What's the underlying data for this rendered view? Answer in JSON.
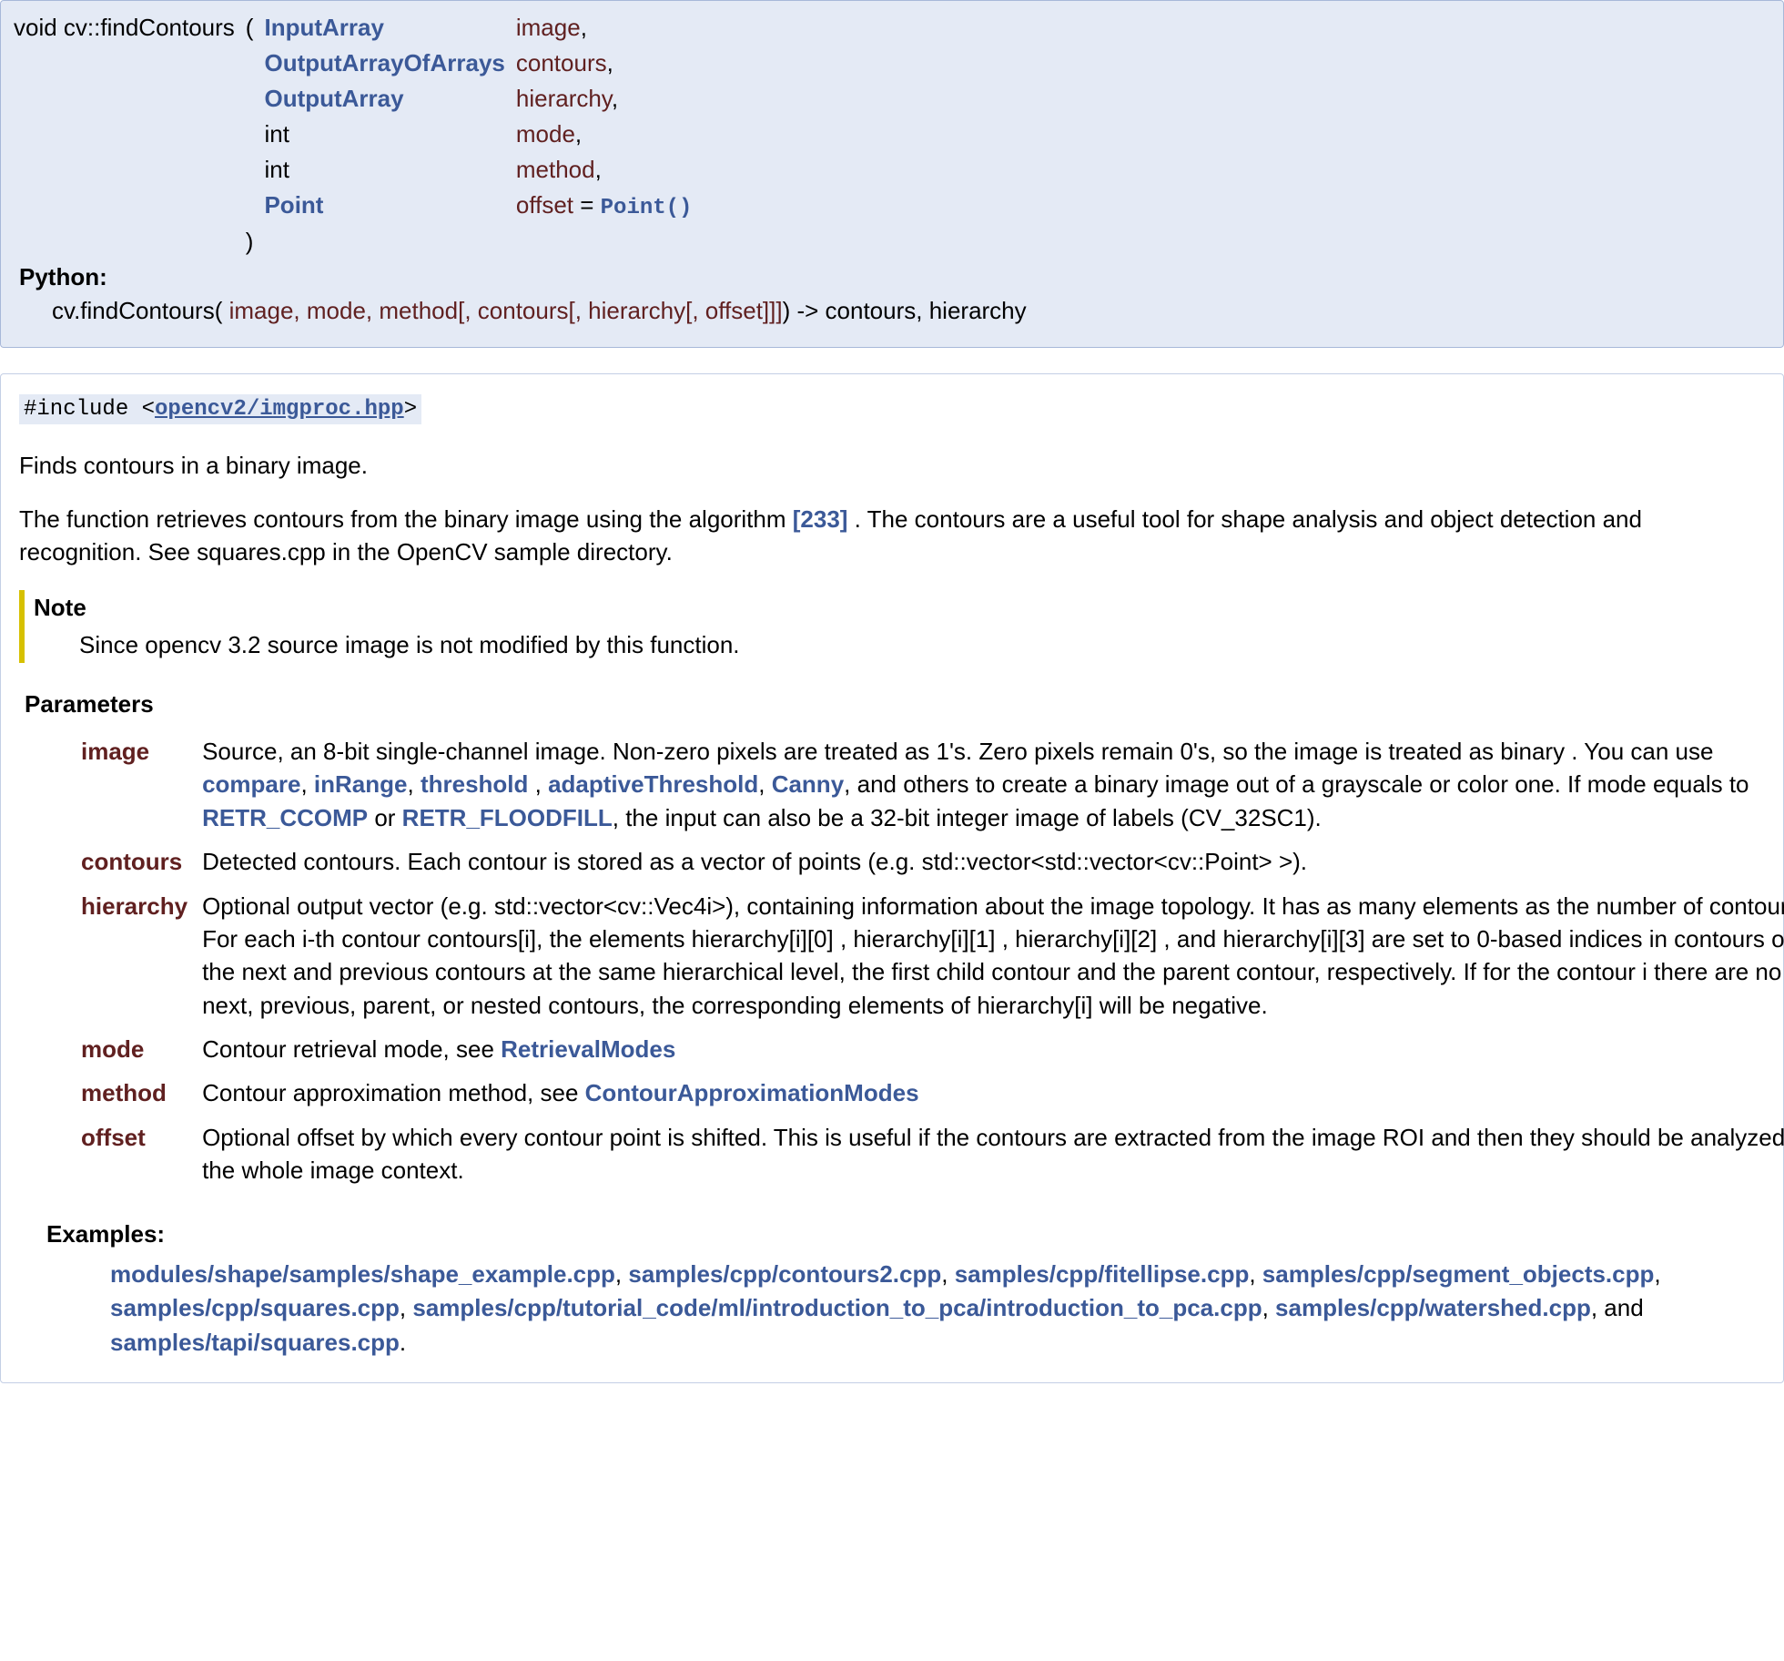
{
  "proto": {
    "rettype": "void cv::findContours",
    "openparen": "(",
    "closeparen": ")",
    "params": [
      {
        "type": "InputArray",
        "type_is_link": true,
        "name": "image",
        "comma": ","
      },
      {
        "type": "OutputArrayOfArrays",
        "type_is_link": true,
        "name": "contours",
        "comma": ","
      },
      {
        "type": "OutputArray",
        "type_is_link": true,
        "name": "hierarchy",
        "comma": ","
      },
      {
        "type": "int",
        "type_is_link": false,
        "name": "mode",
        "comma": ","
      },
      {
        "type": "int",
        "type_is_link": false,
        "name": "method",
        "comma": ","
      },
      {
        "type": "Point",
        "type_is_link": true,
        "name": "offset",
        "default_prefix": " = ",
        "default_code": "Point()",
        "comma": ""
      }
    ]
  },
  "python": {
    "label": "Python:",
    "sig_prefix": "cv.findContours(",
    "args": [
      " image",
      ", mode",
      ", method[",
      ", contours[",
      ", hierarchy[",
      ", offset]]]",
      " "
    ],
    "sig_suffix": ") -> contours, hierarchy"
  },
  "include": {
    "prefix": "#include <",
    "path": "opencv2/imgproc.hpp",
    "suffix": ">"
  },
  "brief": "Finds contours in a binary image.",
  "desc": {
    "part1": "The function retrieves contours from the binary image using the algorithm ",
    "cite": "[233]",
    "part2": " . The contours are a useful tool for shape analysis and object detection and recognition. See squares.cpp in the OpenCV sample directory."
  },
  "note": {
    "heading": "Note",
    "body": "Since opencv 3.2 source image is not modified by this function."
  },
  "params_heading": "Parameters",
  "params": [
    {
      "name": "image",
      "desc": {
        "pre": "Source, an 8-bit single-channel image. Non-zero pixels are treated as 1's. Zero pixels remain 0's, so the image is treated as binary . You can use ",
        "l1": "compare",
        "c1": ", ",
        "l2": "inRange",
        "c2": ", ",
        "l3": "threshold",
        "c3": " , ",
        "l4": "adaptiveThreshold",
        "c4": ", ",
        "l5": "Canny",
        "mid": ", and others to create a binary image out of a grayscale or color one. If mode equals to ",
        "l6": "RETR_CCOMP",
        "c5": " or ",
        "l7": "RETR_FLOODFILL",
        "post": ", the input can also be a 32-bit integer image of labels (CV_32SC1)."
      }
    },
    {
      "name": "contours",
      "desc": {
        "text": "Detected contours. Each contour is stored as a vector of points (e.g. std::vector<std::vector<cv::Point> >)."
      }
    },
    {
      "name": "hierarchy",
      "desc": {
        "text": "Optional output vector (e.g. std::vector<cv::Vec4i>), containing information about the image topology. It has as many elements as the number of contours. For each i-th contour contours[i], the elements hierarchy[i][0] , hierarchy[i][1] , hierarchy[i][2] , and hierarchy[i][3] are set to 0-based indices in contours of the next and previous contours at the same hierarchical level, the first child contour and the parent contour, respectively. If for the contour i there are no next, previous, parent, or nested contours, the corresponding elements of hierarchy[i] will be negative."
      }
    },
    {
      "name": "mode",
      "desc": {
        "pre": "Contour retrieval mode, see ",
        "l1": "RetrievalModes"
      }
    },
    {
      "name": "method",
      "desc": {
        "pre": "Contour approximation method, see ",
        "l1": "ContourApproximationModes"
      }
    },
    {
      "name": "offset",
      "desc": {
        "text": "Optional offset by which every contour point is shifted. This is useful if the contours are extracted from the image ROI and then they should be analyzed in the whole image context."
      }
    }
  ],
  "examples": {
    "heading": "Examples:",
    "items": [
      "modules/shape/samples/shape_example.cpp",
      "samples/cpp/contours2.cpp",
      "samples/cpp/fitellipse.cpp",
      "samples/cpp/segment_objects.cpp",
      "samples/cpp/squares.cpp",
      "samples/cpp/tutorial_code/ml/introduction_to_pca/introduction_to_pca.cpp",
      "samples/cpp/watershed.cpp"
    ],
    "and_word": ", and ",
    "last": "samples/tapi/squares.cpp",
    "sep": ", ",
    "end": "."
  }
}
